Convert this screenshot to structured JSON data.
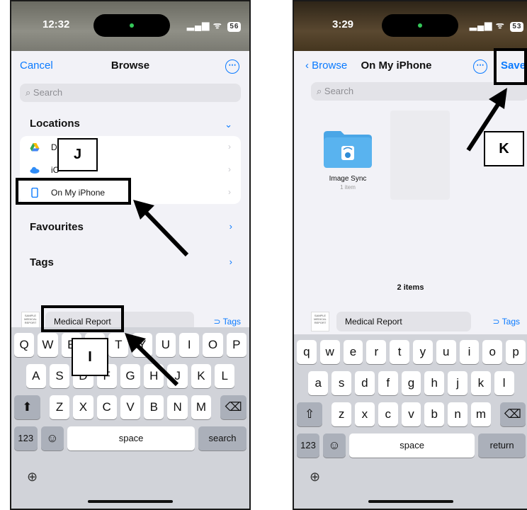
{
  "left_phone": {
    "status": {
      "time": "12:32",
      "signal": "▂▄▆",
      "wifi": "ᯤ",
      "battery": "56"
    },
    "nav": {
      "cancel": "Cancel",
      "title": "Browse",
      "more": "⋯"
    },
    "search": {
      "placeholder": "Search"
    },
    "sections": {
      "locations": "Locations",
      "favourites": "Favourites",
      "tags": "Tags"
    },
    "locations": [
      {
        "label": "D",
        "icon": "google-drive-icon"
      },
      {
        "label": "iC",
        "icon": "icloud-icon"
      },
      {
        "label": "On My iPhone",
        "icon": "iphone-icon"
      }
    ],
    "filename": {
      "value": "Medical Report",
      "thumb_text": "SAMPLE MEDICAL REPORT",
      "tags": "Tags"
    },
    "keyboard": {
      "row1": [
        "Q",
        "W",
        "E",
        "R",
        "T",
        "Y",
        "U",
        "I",
        "O",
        "P"
      ],
      "row2": [
        "A",
        "S",
        "D",
        "F",
        "G",
        "H",
        "J",
        "K",
        "L"
      ],
      "row3": [
        "Z",
        "X",
        "C",
        "V",
        "B",
        "N",
        "M"
      ],
      "numbers": "123",
      "space": "space",
      "action": "search"
    },
    "annotations": {
      "J": "J",
      "I": "I"
    }
  },
  "right_phone": {
    "status": {
      "time": "3:29",
      "signal": "▂▄▆",
      "wifi": "ᯤ",
      "battery": "53"
    },
    "nav": {
      "back": "Browse",
      "title": "On My iPhone",
      "more": "⋯",
      "save": "Save"
    },
    "search": {
      "placeholder": "Search"
    },
    "folder": {
      "name": "Image Sync",
      "count": "1 item"
    },
    "items_count": "2 items",
    "filename": {
      "value": "Medical Report",
      "thumb_text": "SAMPLE MEDICAL REPORT",
      "tags": "Tags"
    },
    "keyboard": {
      "row1": [
        "q",
        "w",
        "e",
        "r",
        "t",
        "y",
        "u",
        "i",
        "o",
        "p"
      ],
      "row2": [
        "a",
        "s",
        "d",
        "f",
        "g",
        "h",
        "j",
        "k",
        "l"
      ],
      "row3": [
        "z",
        "x",
        "c",
        "v",
        "b",
        "n",
        "m"
      ],
      "numbers": "123",
      "space": "space",
      "action": "return"
    },
    "annotations": {
      "K": "K"
    }
  },
  "colors": {
    "accent": "#0a7aff",
    "callout": "#000000"
  }
}
